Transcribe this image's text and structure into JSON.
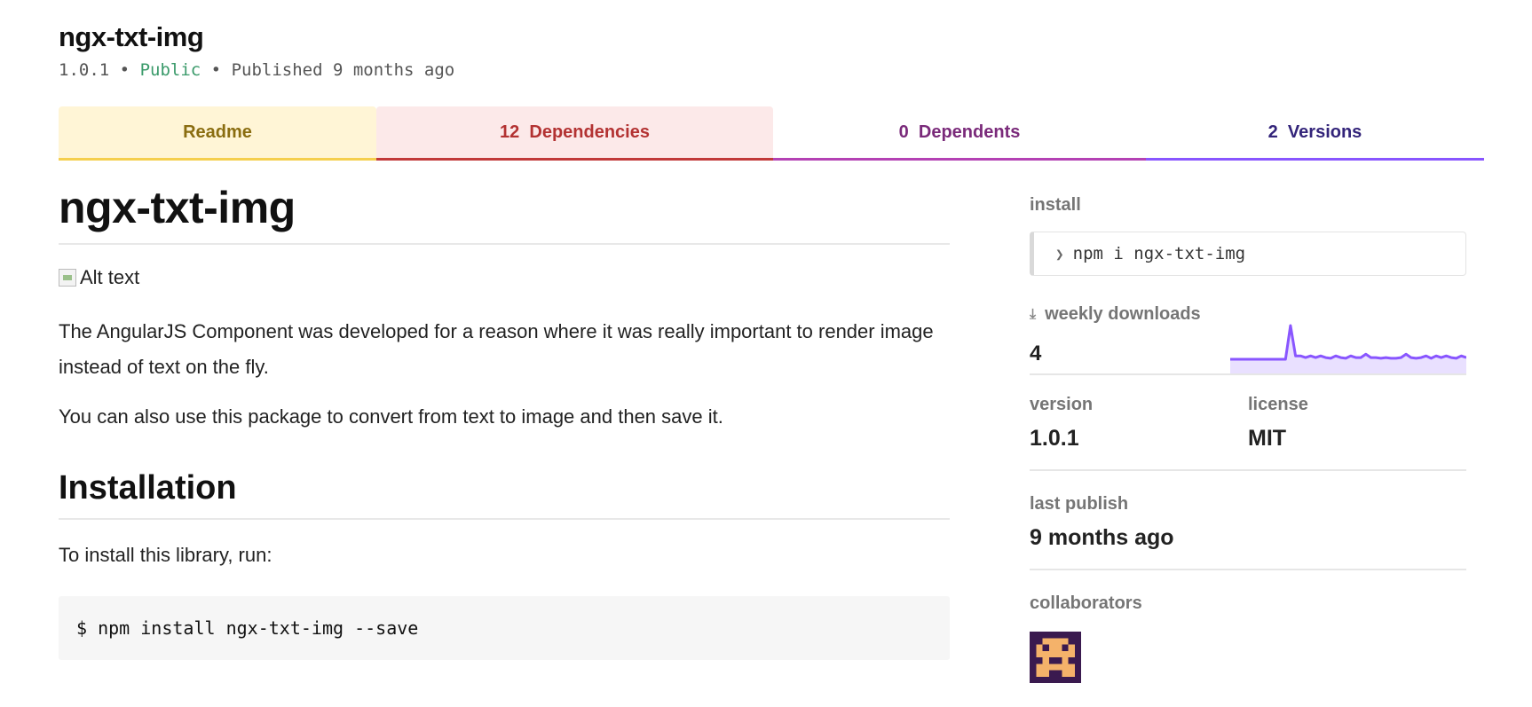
{
  "header": {
    "package_name": "ngx-txt-img",
    "version": "1.0.1",
    "separator": "•",
    "visibility": "Public",
    "published": "Published 9 months ago"
  },
  "tabs": [
    {
      "label": "Readme"
    },
    {
      "count": "12",
      "label": "Dependencies"
    },
    {
      "count": "0",
      "label": "Dependents"
    },
    {
      "count": "2",
      "label": "Versions"
    }
  ],
  "readme": {
    "title": "ngx-txt-img",
    "image_alt": "Alt text",
    "paragraph1": "The AngularJS Component was developed for a reason where it was really important to render image instead of text on the fly.",
    "paragraph2": "You can also use this package to convert from text to image and then save it.",
    "installation_heading": "Installation",
    "install_intro": "To install this library, run:",
    "install_code": "$ npm install ngx-txt-img --save"
  },
  "sidebar": {
    "install_label": "install",
    "install_command": "npm i ngx-txt-img",
    "downloads_label": "weekly downloads",
    "downloads_count": "4",
    "downloads_series": [
      0,
      0,
      0,
      0,
      0,
      0,
      0,
      0,
      0,
      0,
      0,
      0,
      10,
      1,
      1,
      0.5,
      1,
      0.5,
      1,
      0.5,
      0.3,
      1,
      0.5,
      0.3,
      1,
      0.5,
      0.5,
      1.5,
      0.5,
      0.5,
      0.3,
      0.5,
      0.3,
      0.3,
      0.5,
      1.5,
      0.5,
      0.3,
      0.5,
      1,
      0.3,
      1,
      0.5,
      1,
      0.5,
      0.3,
      1,
      0.5
    ],
    "version_label": "version",
    "version_value": "1.0.1",
    "license_label": "license",
    "license_value": "MIT",
    "last_publish_label": "last publish",
    "last_publish_value": "9 months ago",
    "collaborators_label": "collaborators"
  },
  "colors": {
    "public": "#3a9a6a",
    "sparkline": "#8956ff",
    "avatar_bg": "#3a1a4f",
    "avatar_fg": "#f4b26a"
  }
}
